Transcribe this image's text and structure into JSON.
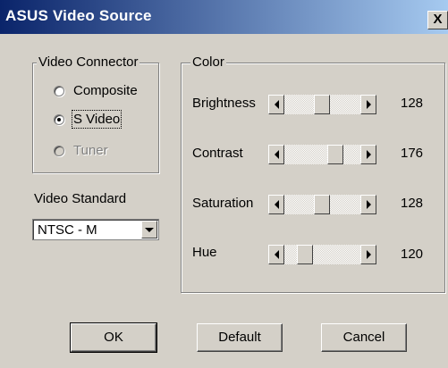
{
  "window": {
    "title": "ASUS Video Source",
    "close_glyph": "X"
  },
  "video_connector": {
    "label": "Video Connector",
    "options": [
      {
        "label": "Composite",
        "checked": false,
        "disabled": false
      },
      {
        "label": "S Video",
        "checked": true,
        "disabled": false
      },
      {
        "label": "Tuner",
        "checked": false,
        "disabled": true
      }
    ]
  },
  "video_standard": {
    "label": "Video Standard",
    "selected": "NTSC - M"
  },
  "color": {
    "label": "Color",
    "sliders": [
      {
        "label": "Brightness",
        "value": "128"
      },
      {
        "label": "Contrast",
        "value": "176"
      },
      {
        "label": "Saturation",
        "value": "128"
      },
      {
        "label": "Hue",
        "value": "120"
      }
    ]
  },
  "buttons": {
    "ok": "OK",
    "default": "Default",
    "cancel": "Cancel"
  }
}
